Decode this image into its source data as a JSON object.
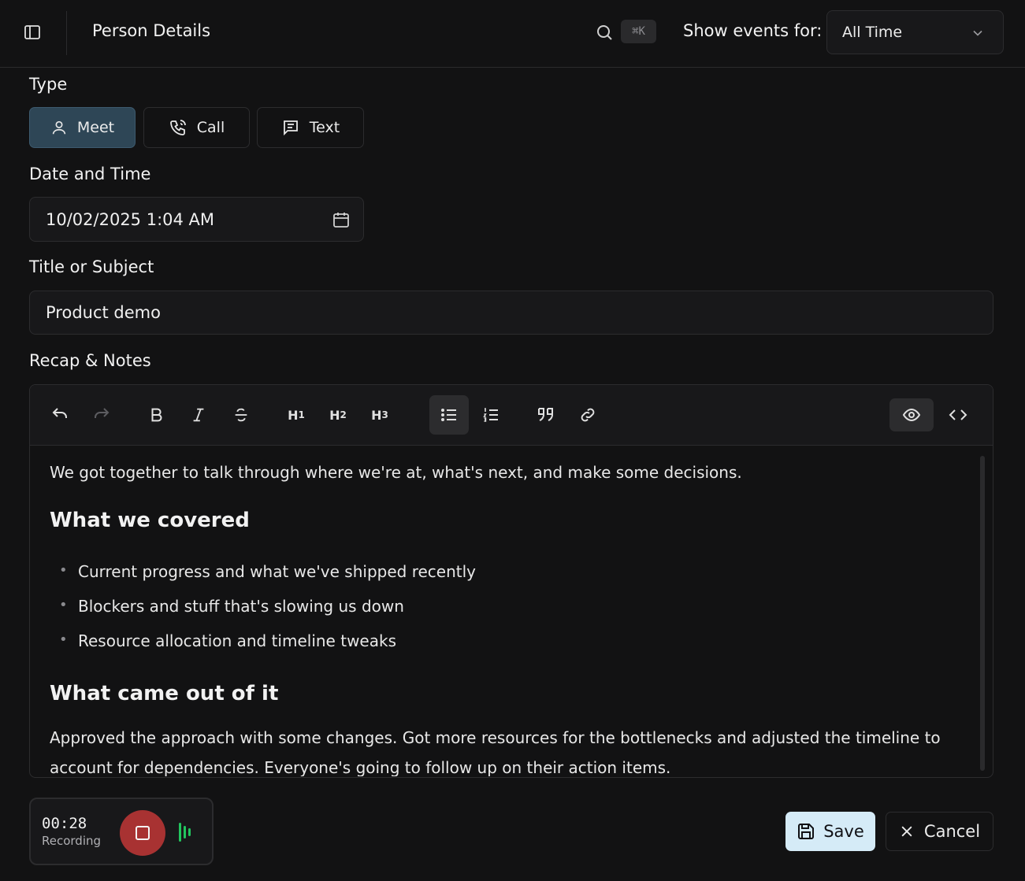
{
  "header": {
    "title": "Person Details",
    "search_shortcut": "⌘K",
    "show_events_label": "Show events for:",
    "show_events_value": "All Time"
  },
  "form": {
    "type_label": "Type",
    "types": [
      {
        "label": "Meet",
        "icon": "person-icon",
        "selected": true
      },
      {
        "label": "Call",
        "icon": "phone-icon",
        "selected": false
      },
      {
        "label": "Text",
        "icon": "message-icon",
        "selected": false
      }
    ],
    "datetime_label": "Date and Time",
    "datetime_value": "10/02/2025 1:04 AM",
    "title_label": "Title or Subject",
    "title_value": "Product demo",
    "notes_label": "Recap & Notes"
  },
  "editor": {
    "toolbar": {
      "h1": "H",
      "h1_sub": "1",
      "h2": "H",
      "h2_sub": "2",
      "h3": "H",
      "h3_sub": "3"
    },
    "content": {
      "intro": "We got together to talk through where we're at, what's next, and make some decisions.",
      "heading1": "What we covered",
      "bullets": [
        "Current progress and what we've shipped recently",
        "Blockers and stuff that's slowing us down",
        "Resource allocation and timeline tweaks"
      ],
      "heading2": "What came out of it",
      "outcome": "Approved the approach with some changes. Got more resources for the bottlenecks and adjusted the timeline to account for dependencies. Everyone's going to follow up on their action items."
    }
  },
  "recorder": {
    "time": "00:28",
    "status": "Recording"
  },
  "actions": {
    "save_label": "Save",
    "cancel_label": "Cancel"
  },
  "colors": {
    "background": "#121213",
    "active_type": "#2e4656",
    "save_button": "#d5ebf7",
    "record_stop": "#a83232",
    "waveform": "#22c55e"
  }
}
